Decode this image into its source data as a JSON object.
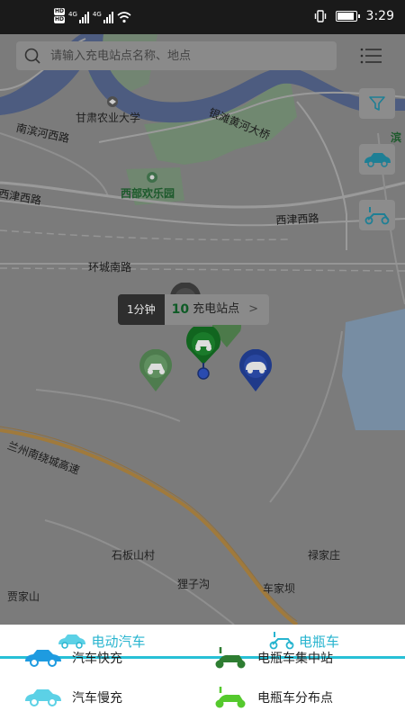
{
  "status_bar": {
    "time": "3:29",
    "network_left": "4G",
    "network_right": "4G",
    "hd": "HD"
  },
  "search": {
    "placeholder": "请输入充电站点名称、地点"
  },
  "map": {
    "labels": {
      "university": "甘肃农业大学",
      "bridge": "银滩黄河大桥",
      "west_road": "南滨河西路",
      "park": "西部欢乐园",
      "xijin_left": "西津西路",
      "xijin_right": "西津西路",
      "ring_road": "环城南路",
      "expressway": "兰州南绕城高速",
      "shibanshan": "石板山村",
      "lujiazhuang": "禄家庄",
      "lizigou": "狸子沟",
      "chejiaba": "车家坝",
      "jiajiashan": "贾家山",
      "edge": "滨"
    }
  },
  "nearby": {
    "duration": "1分钟",
    "count": "10",
    "count_label": "充电站点",
    "arrow": ">"
  },
  "tabs": {
    "car": "电动汽车",
    "ebike": "电瓶车"
  },
  "legend": {
    "car_fast": "汽车快充",
    "car_slow": "汽车慢充",
    "ebike_hub": "电瓶车集中站",
    "ebike_spot": "电瓶车分布点"
  },
  "colors": {
    "accent": "#27b4cf",
    "car_pin": "#1f3a8a",
    "ebike_pin": "#2e7d32",
    "ebike_spot": "#55c92d"
  }
}
